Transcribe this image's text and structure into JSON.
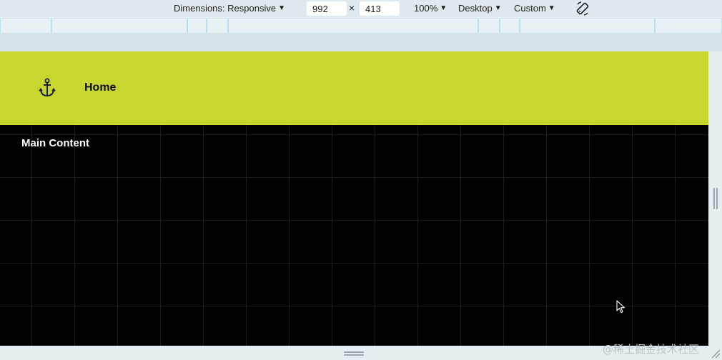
{
  "toolbar": {
    "dimensions_label": "Dimensions: Responsive",
    "width_value": "992",
    "times_symbol": "×",
    "height_value": "413",
    "zoom_label": "100%",
    "device_label": "Desktop",
    "throttle_label": "Custom",
    "caret": "▼",
    "rotate_icon": "rotate-icon"
  },
  "site": {
    "header_color": "#c8d630",
    "logo_icon": "anchor-icon",
    "nav_home_label": "Home",
    "main_content_label": "Main Content"
  },
  "watermark": "@稀土掘金技术社区"
}
